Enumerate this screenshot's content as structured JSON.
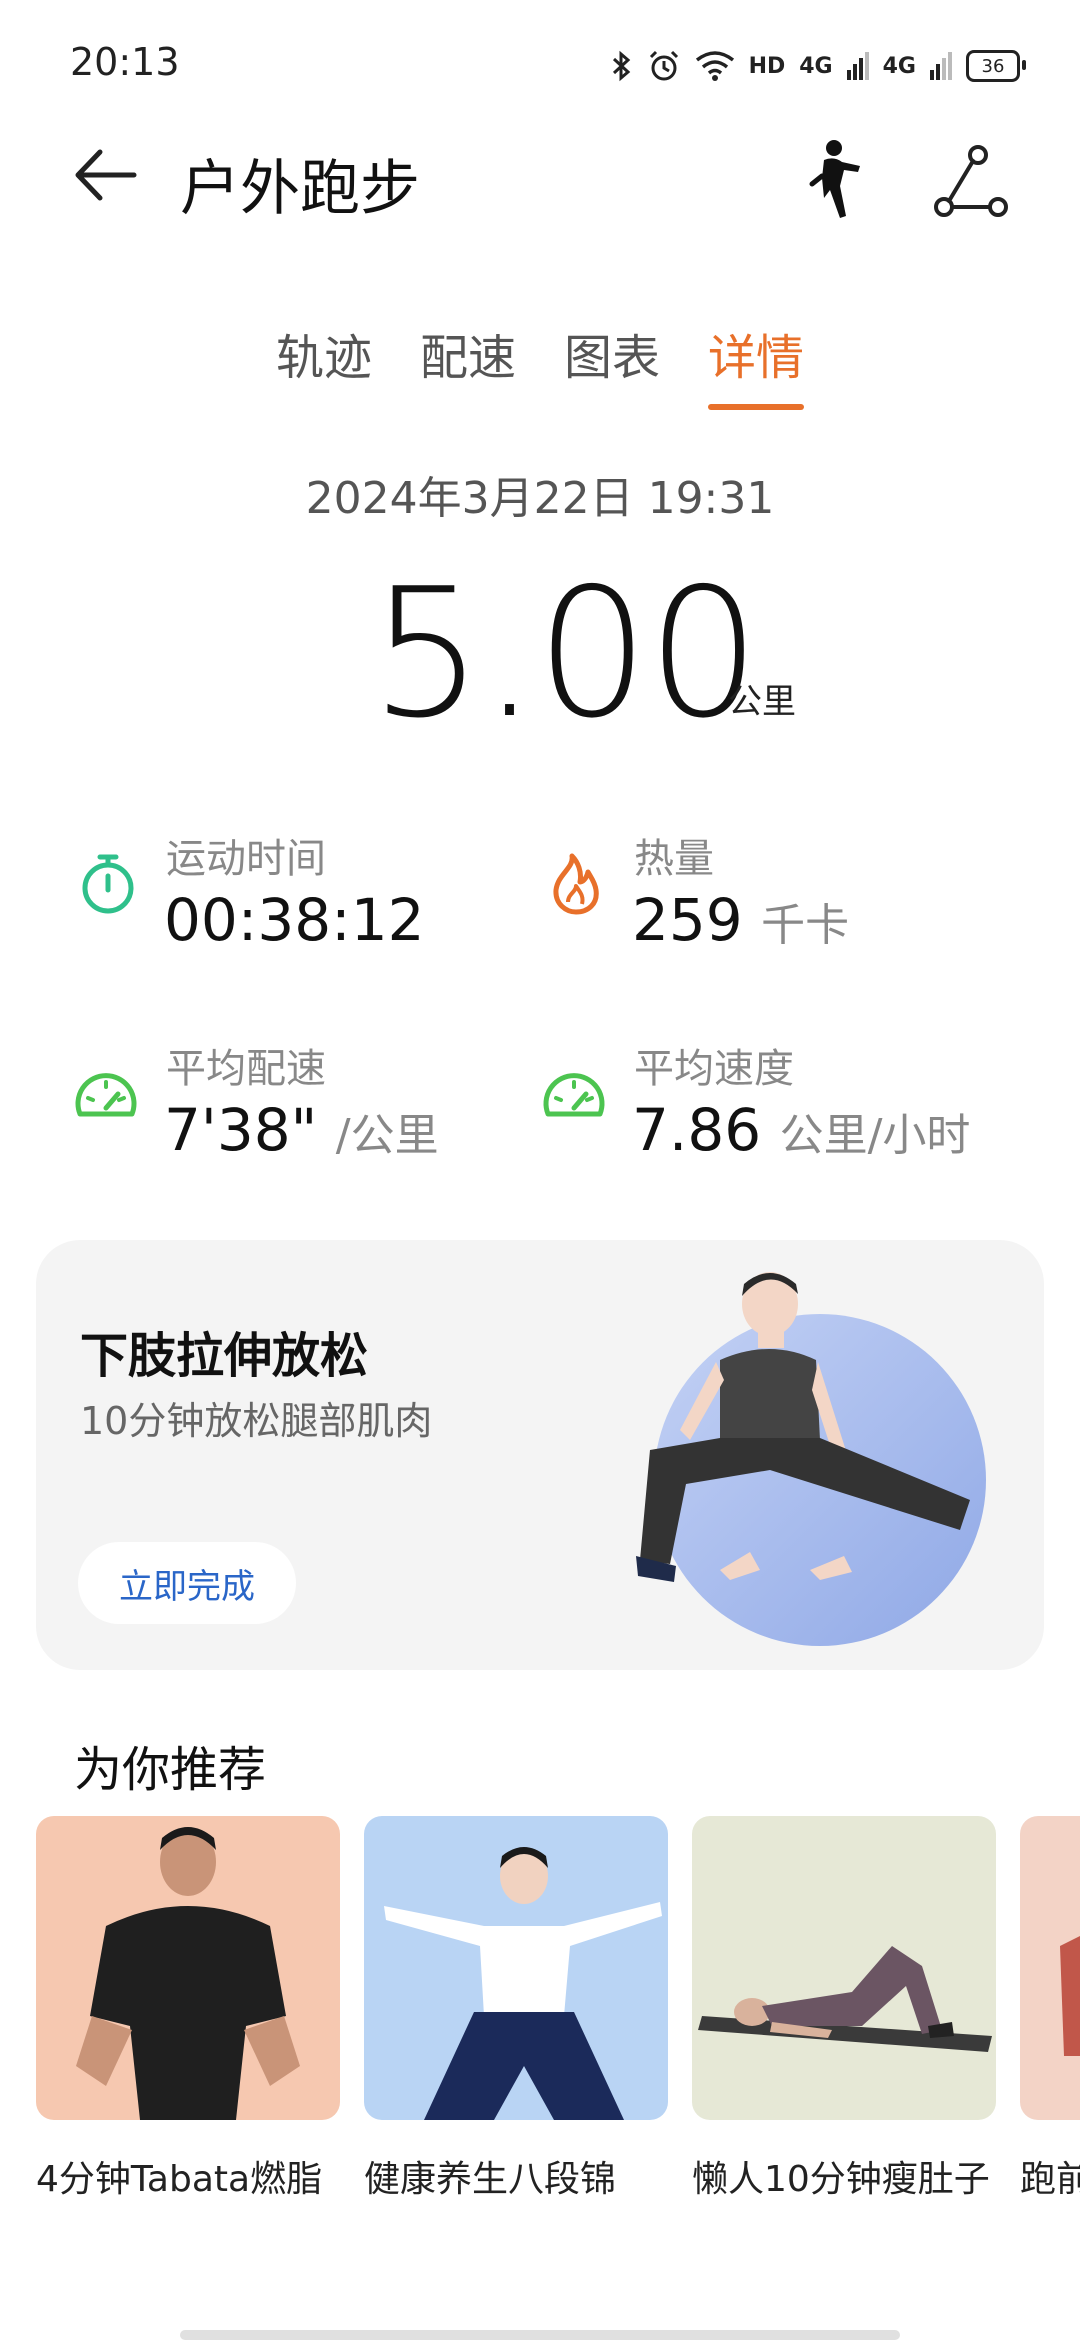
{
  "status_bar": {
    "time": "20:13",
    "network_hd": "HD",
    "network_4g_1": "4G",
    "network_4g_2": "4G",
    "battery": "36"
  },
  "header": {
    "title": "户外跑步",
    "icons": [
      "back-arrow-icon",
      "runner-icon",
      "route-share-icon"
    ]
  },
  "tabs": [
    {
      "label": "轨迹",
      "active": false
    },
    {
      "label": "配速",
      "active": false
    },
    {
      "label": "图表",
      "active": false
    },
    {
      "label": "详情",
      "active": true
    }
  ],
  "summary": {
    "date": "2024年3月22日 19:31",
    "distance": "5.00",
    "distance_unit": "公里"
  },
  "stats": {
    "duration": {
      "label": "运动时间",
      "value": "00:38:12",
      "unit": "",
      "icon": "stopwatch-icon",
      "color": "#2fc08b"
    },
    "calories": {
      "label": "热量",
      "value": "259",
      "unit": "千卡",
      "icon": "flame-icon",
      "color": "#e8702a"
    },
    "avg_pace": {
      "label": "平均配速",
      "value": "7'38\"",
      "unit": "/公里",
      "icon": "speedometer-icon",
      "color": "#4cc450"
    },
    "avg_speed": {
      "label": "平均速度",
      "value": "7.86",
      "unit": "公里/小时",
      "icon": "speedometer-icon",
      "color": "#4cc450"
    }
  },
  "stretch_card": {
    "title": "下肢拉伸放松",
    "subtitle": "10分钟放松腿部肌肉",
    "button": "立即完成"
  },
  "recommendations": {
    "title": "为你推荐",
    "items": [
      {
        "label": "4分钟Tabata燃脂",
        "bg": "#f6c8b0"
      },
      {
        "label": "健康养生八段锦",
        "bg": "#b9d4f4"
      },
      {
        "label": "懒人10分钟瘦肚子",
        "bg": "#e6e8d6"
      },
      {
        "label": "跑前",
        "bg": "#f3d3c6"
      }
    ]
  },
  "colors": {
    "accent": "#e8702a",
    "link": "#2a66c8"
  }
}
